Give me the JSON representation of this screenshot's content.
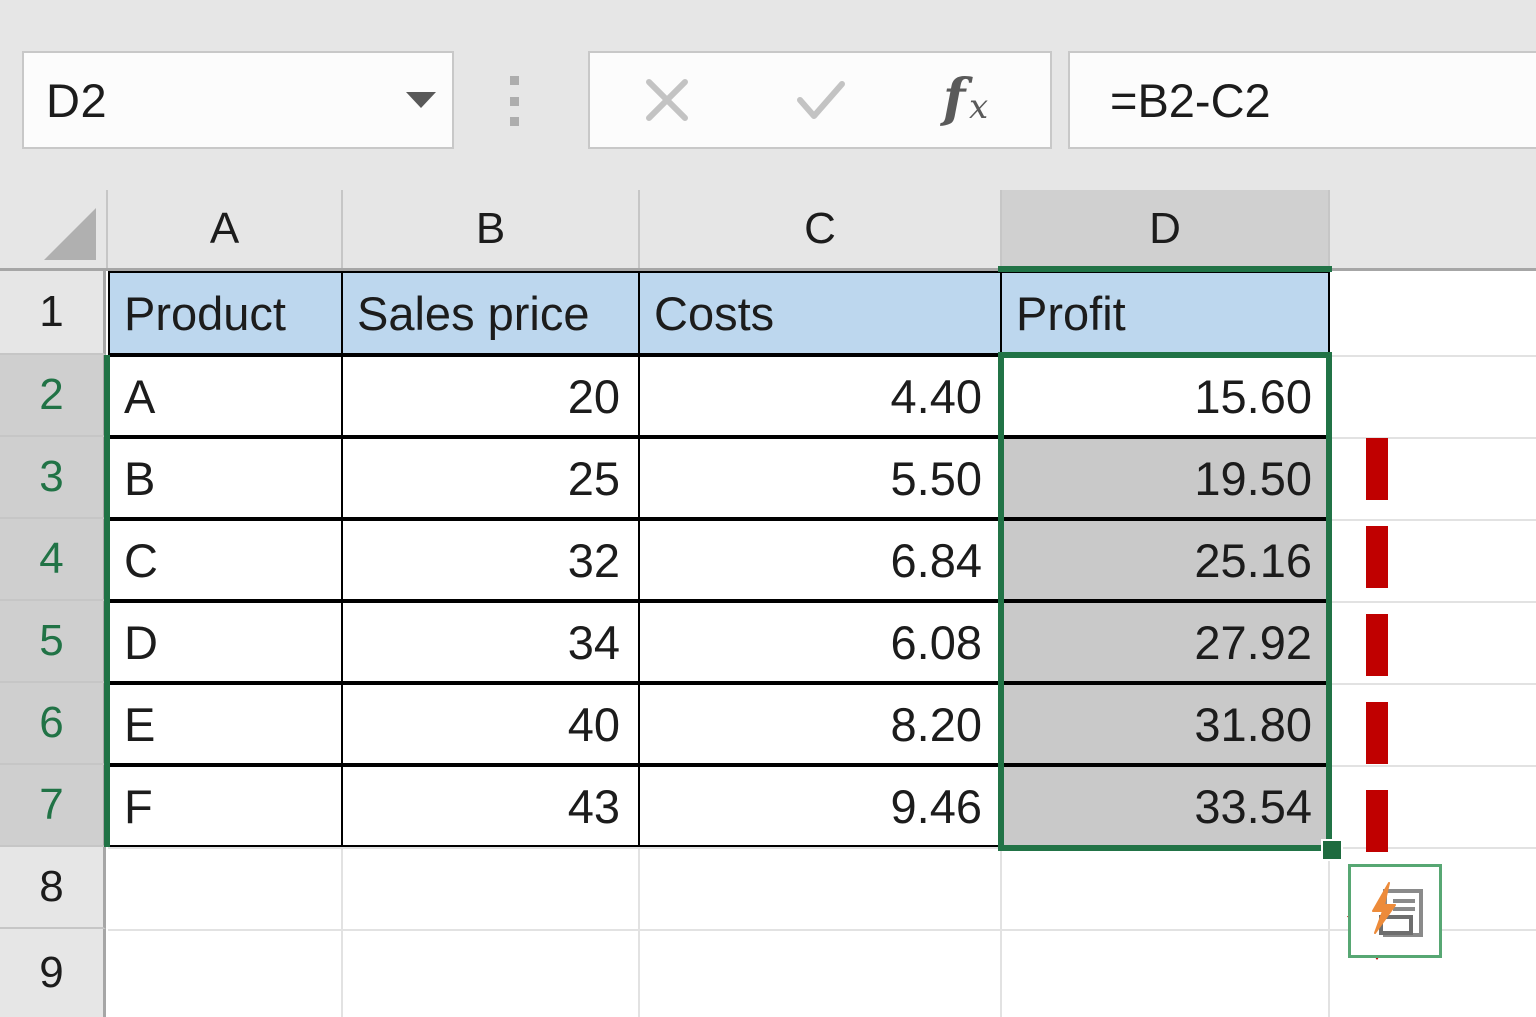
{
  "app": "Microsoft Excel",
  "formula_bar": {
    "name_box": {
      "value": "D2",
      "dropdown_icon": "chevron-down-icon"
    },
    "grip_icon": "vertical-dots-grip-icon",
    "cancel_icon": "close-x-icon",
    "enter_icon": "checkmark-icon",
    "insert_function_icon": "fx-icon",
    "formula": "=B2-C2"
  },
  "sheet": {
    "select_all_icon": "select-all-triangle-icon",
    "column_headers": [
      "A",
      "B",
      "C",
      "D"
    ],
    "selected_column": "D",
    "row_headers": [
      "1",
      "2",
      "3",
      "4",
      "5",
      "6",
      "7",
      "8",
      "9"
    ],
    "selected_rows": [
      "2",
      "3",
      "4",
      "5",
      "6",
      "7"
    ],
    "table": {
      "headers": [
        "Product",
        "Sales price",
        "Costs",
        "Profit"
      ],
      "rows": [
        {
          "product": "A",
          "sales_price": "20",
          "costs": "4.40",
          "profit": "15.60"
        },
        {
          "product": "B",
          "sales_price": "25",
          "costs": "5.50",
          "profit": "19.50"
        },
        {
          "product": "C",
          "sales_price": "32",
          "costs": "6.84",
          "profit": "25.16"
        },
        {
          "product": "D",
          "sales_price": "34",
          "costs": "6.08",
          "profit": "27.92"
        },
        {
          "product": "E",
          "sales_price": "40",
          "costs": "8.20",
          "profit": "31.80"
        },
        {
          "product": "F",
          "sales_price": "43",
          "costs": "9.46",
          "profit": "33.54"
        }
      ]
    },
    "active_cell": "D2",
    "selection_range": "D2:D7",
    "fill_handle_icon": "fill-handle-square-icon",
    "smart_tag_icon": "autofill-options-icon"
  },
  "annotation": {
    "arrow_icon": "red-dashed-down-arrow-icon",
    "arrow_color": "#c00000"
  },
  "colors": {
    "header_fill": "#bdd7ee",
    "selection_fill": "#c9c9c9",
    "selection_border": "#217346",
    "chrome": "#e6e6e6",
    "annotation_red": "#c00000"
  }
}
